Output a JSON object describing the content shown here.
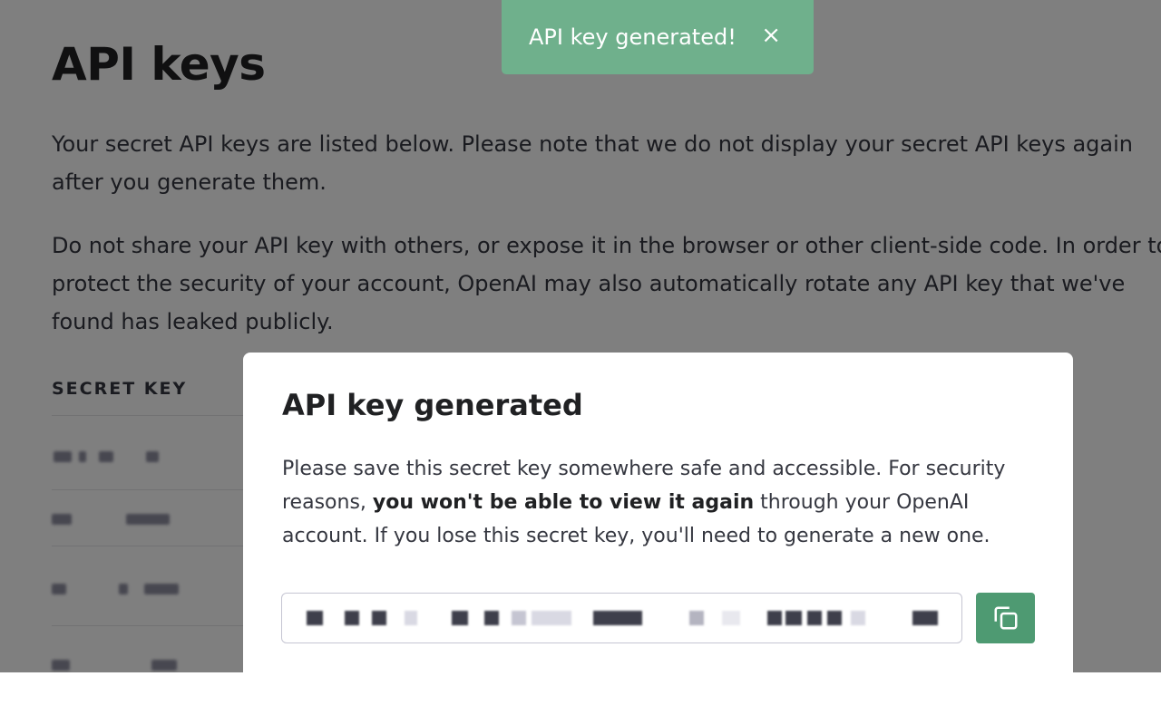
{
  "page": {
    "title": "API keys",
    "paragraph1_line1": "Your secret API keys are listed below. Please note that we do not display your secret API keys again",
    "paragraph1_line2": "after you generate them.",
    "paragraph2_line1": "Do not share your API key with others, or expose it in the browser or other client-side code. In order to",
    "paragraph2_line2": "protect the security of your account, OpenAI may also automatically rotate any API key that we've",
    "paragraph2_line3": "found has leaked publicly.",
    "table_header": "SECRET KEY"
  },
  "toast": {
    "message": "API key generated!",
    "close_glyph": "×"
  },
  "modal": {
    "title": "API key generated",
    "body_line1": "Please save this secret key somewhere safe and accessible. For security",
    "body_line2_prefix": "reasons, ",
    "body_line2_bold": "you won't be able to view it again",
    "body_line2_suffix": " through your OpenAI",
    "body_line3": "account. If you lose this secret key, you'll need to generate a new one.",
    "copy_icon": "copy-icon"
  },
  "colors": {
    "toast_bg": "#6fb08c",
    "copy_button_bg": "#4e9a72",
    "overlay": "rgba(0,0,0,0.5)"
  }
}
